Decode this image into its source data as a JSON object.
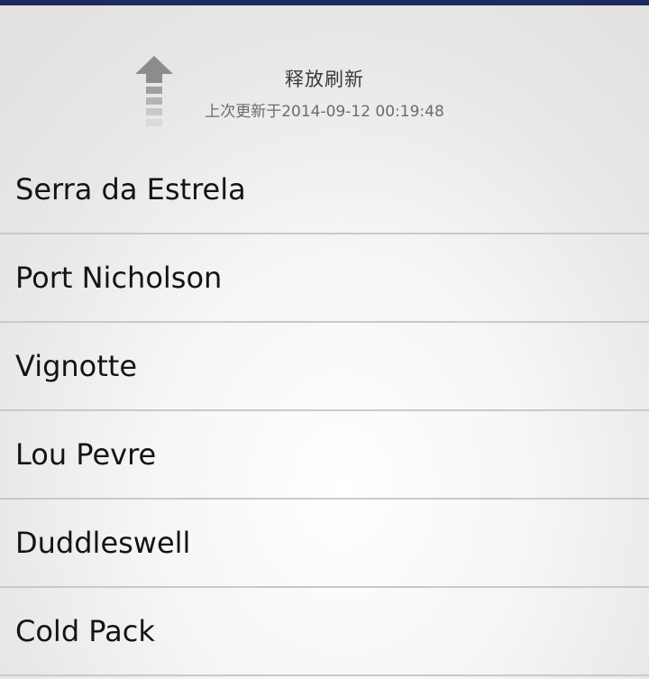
{
  "refresh": {
    "status": "释放刷新",
    "last_updated": "上次更新于2014-09-12 00:19:48",
    "icon": "arrow-up-icon"
  },
  "list": {
    "items": [
      {
        "label": "Serra da Estrela"
      },
      {
        "label": "Port Nicholson"
      },
      {
        "label": "Vignotte"
      },
      {
        "label": "Lou Pevre"
      },
      {
        "label": "Duddleswell"
      },
      {
        "label": "Cold Pack"
      }
    ]
  },
  "colors": {
    "top_bar": "#1f2a5e",
    "arrow": "#8c8c8c",
    "divider": "#c9c9c9"
  }
}
